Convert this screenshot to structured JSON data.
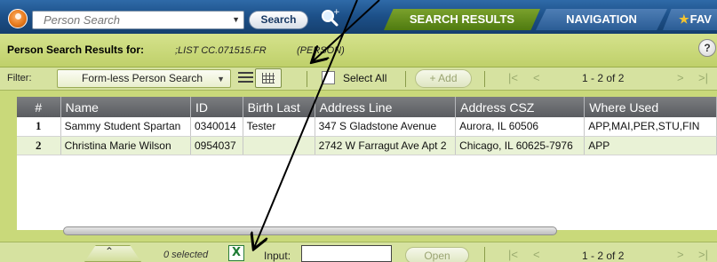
{
  "topbar": {
    "search_placeholder": "Person Search",
    "search_button": "Search",
    "tabs": [
      {
        "label": "SEARCH RESULTS"
      },
      {
        "label": "NAVIGATION"
      },
      {
        "label": "FAV"
      }
    ]
  },
  "results_header": {
    "label": "Person Search Results for:",
    "list_name": ";LIST CC.071515.FR",
    "type": "(PERSON)",
    "help": "?"
  },
  "toolbar": {
    "filter_label": "Filter:",
    "filter_value": "Form-less Person Search",
    "select_all": "Select All",
    "add_button": "+ Add",
    "pager": {
      "first": "|<",
      "prev": "<",
      "range": "1 - 2 of 2",
      "next": ">",
      "last": ">|"
    }
  },
  "table": {
    "columns": [
      "#",
      "Name",
      "ID",
      "Birth Last",
      "Address Line",
      "Address CSZ",
      "Where Used"
    ],
    "rows": [
      {
        "num": "1",
        "name": "Sammy Student Spartan",
        "id": "0340014",
        "birth_last": "Tester",
        "address": "347 S Gladstone Avenue",
        "csz": "Aurora, IL 60506",
        "where": "APP,MAI,PER,STU,FIN"
      },
      {
        "num": "2",
        "name": "Christina Marie Wilson",
        "id": "0954037",
        "birth_last": "",
        "address": "2742 W Farragut Ave Apt 2",
        "csz": "Chicago, IL 60625-7976",
        "where": "APP"
      }
    ]
  },
  "bottom": {
    "collapse": "⌃",
    "selected": "0 selected",
    "input_label": "Input:",
    "input_value": "",
    "open_button": "Open",
    "pager": {
      "first": "|<",
      "prev": "<",
      "range": "1 - 2 of 2",
      "next": ">",
      "last": ">|"
    }
  },
  "colors": {
    "topbar": "#1c4f87",
    "panel": "#c9d97a",
    "results_tab": "#5f8a18",
    "table_header": "#6b6d70",
    "annotation": "#000000"
  }
}
